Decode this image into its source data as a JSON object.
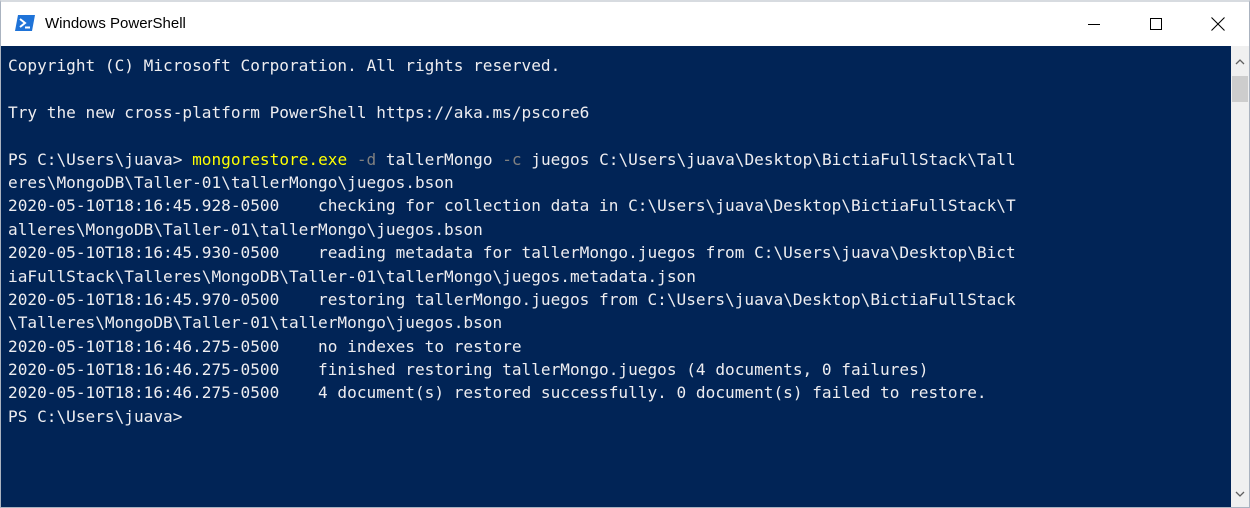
{
  "window": {
    "title": "Windows PowerShell",
    "buttons": [
      "minimize",
      "maximize",
      "close"
    ]
  },
  "colors": {
    "console_background": "#012456",
    "console_text": "#eeedf0",
    "command": "#ffff00",
    "parameter": "#808080",
    "icon_blue": "#1e73d8"
  },
  "icons": {
    "app": "powershell-icon",
    "minimize": "minimize-icon",
    "maximize": "maximize-icon",
    "close": "close-icon",
    "scroll_up": "scroll-up-arrow-icon",
    "scroll_down": "scroll-down-arrow-icon"
  },
  "console": {
    "lines": [
      [
        {
          "text": "Copyright (C) Microsoft Corporation. All rights reserved."
        }
      ],
      [
        {
          "text": ""
        }
      ],
      [
        {
          "text": "Try the new cross-platform PowerShell https://aka.ms/pscore6"
        }
      ],
      [
        {
          "text": ""
        }
      ],
      [
        {
          "text": "PS C:\\Users\\juava> "
        },
        {
          "text": "mongorestore.exe",
          "style": "cmd"
        },
        {
          "text": " "
        },
        {
          "text": "-d",
          "style": "param"
        },
        {
          "text": " tallerMongo "
        },
        {
          "text": "-c",
          "style": "param"
        },
        {
          "text": " juegos C:\\Users\\juava\\Desktop\\BictiaFullStack\\Tall"
        }
      ],
      [
        {
          "text": "eres\\MongoDB\\Taller-01\\tallerMongo\\juegos.bson"
        }
      ],
      [
        {
          "text": "2020-05-10T18:16:45.928-0500    checking for collection data in C:\\Users\\juava\\Desktop\\BictiaFullStack\\T"
        }
      ],
      [
        {
          "text": "alleres\\MongoDB\\Taller-01\\tallerMongo\\juegos.bson"
        }
      ],
      [
        {
          "text": "2020-05-10T18:16:45.930-0500    reading metadata for tallerMongo.juegos from C:\\Users\\juava\\Desktop\\Bict"
        }
      ],
      [
        {
          "text": "iaFullStack\\Talleres\\MongoDB\\Taller-01\\tallerMongo\\juegos.metadata.json"
        }
      ],
      [
        {
          "text": "2020-05-10T18:16:45.970-0500    restoring tallerMongo.juegos from C:\\Users\\juava\\Desktop\\BictiaFullStack"
        }
      ],
      [
        {
          "text": "\\Talleres\\MongoDB\\Taller-01\\tallerMongo\\juegos.bson"
        }
      ],
      [
        {
          "text": "2020-05-10T18:16:46.275-0500    no indexes to restore"
        }
      ],
      [
        {
          "text": "2020-05-10T18:16:46.275-0500    finished restoring tallerMongo.juegos (4 documents, 0 failures)"
        }
      ],
      [
        {
          "text": "2020-05-10T18:16:46.275-0500    4 document(s) restored successfully. 0 document(s) failed to restore."
        }
      ],
      [
        {
          "text": "PS C:\\Users\\juava>"
        }
      ]
    ]
  }
}
